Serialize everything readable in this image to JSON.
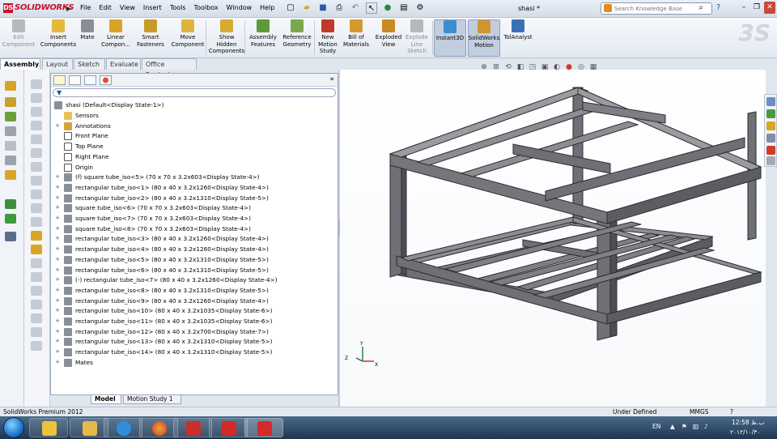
{
  "app": {
    "logo_text": "SOLIDWORKS",
    "doc_title": "shasi *",
    "menu": [
      "File",
      "Edit",
      "View",
      "Insert",
      "Tools",
      "Toolbox",
      "Window",
      "Help"
    ],
    "search_placeholder": "Search Knowledge Base"
  },
  "ribbon": {
    "buttons": [
      {
        "label": "Edit Component",
        "state": "disabled",
        "icon_color": "#b8b8b8"
      },
      {
        "label": "Insert Components",
        "state": "normal",
        "icon_color": "#e2b93b"
      },
      {
        "label": "Mate",
        "state": "normal",
        "icon_color": "#8a8f96"
      },
      {
        "label": "Linear Compon...",
        "state": "normal",
        "icon_color": "#d9a327"
      },
      {
        "label": "Smart Fasteners",
        "state": "normal",
        "icon_color": "#c79a2a"
      },
      {
        "label": "Move Component",
        "state": "normal",
        "icon_color": "#e0b240"
      },
      {
        "label": "Show Hidden Components",
        "state": "normal",
        "icon_color": "#d7aa33"
      },
      {
        "label": "Assembly Features",
        "state": "normal",
        "icon_color": "#5e9a3a"
      },
      {
        "label": "Reference Geometry",
        "state": "normal",
        "icon_color": "#7aa84c"
      },
      {
        "label": "New Motion Study",
        "state": "normal",
        "icon_color": "#c0392b"
      },
      {
        "label": "Bill of Materials",
        "state": "normal",
        "icon_color": "#d29b2c"
      },
      {
        "label": "Exploded View",
        "state": "normal",
        "icon_color": "#c88a22"
      },
      {
        "label": "Explode Line Sketch",
        "state": "disabled",
        "icon_color": "#b8b8b8"
      },
      {
        "label": "Instant3D",
        "state": "active",
        "icon_color": "#3b8fd1"
      },
      {
        "label": "SolidWorks Motion",
        "state": "active",
        "icon_color": "#d09430"
      },
      {
        "label": "TolAnalyst",
        "state": "normal",
        "icon_color": "#3b6fb5"
      }
    ]
  },
  "command_tabs": [
    "Assembly",
    "Layout",
    "Sketch",
    "Evaluate",
    "Office Products"
  ],
  "tree": {
    "root": "shasi  (Default<Display State-1>)",
    "items": [
      {
        "label": "Sensors",
        "icon": "sensor-icon"
      },
      {
        "label": "Annotations",
        "icon": "annotations-icon"
      },
      {
        "label": "Front Plane",
        "icon": "plane-icon"
      },
      {
        "label": "Top Plane",
        "icon": "plane-icon"
      },
      {
        "label": "Right Plane",
        "icon": "plane-icon"
      },
      {
        "label": "Origin",
        "icon": "origin-icon"
      },
      {
        "label": "(f) square tube_iso<5> (70 x 70 x 3.2x603<Display State-4>)",
        "icon": "part-icon"
      },
      {
        "label": "rectangular tube_iso<1> (80 x 40 x 3.2x1260<Display State-4>)",
        "icon": "part-icon"
      },
      {
        "label": "rectangular tube_iso<2> (80 x 40 x 3.2x1310<Display State-5>)",
        "icon": "part-icon"
      },
      {
        "label": "square tube_iso<6> (70 x 70 x 3.2x603<Display State-4>)",
        "icon": "part-icon"
      },
      {
        "label": "square tube_iso<7> (70 x 70 x 3.2x603<Display State-4>)",
        "icon": "part-icon"
      },
      {
        "label": "square tube_iso<8> (70 x 70 x 3.2x603<Display State-4>)",
        "icon": "part-icon"
      },
      {
        "label": "rectangular tube_iso<3> (80 x 40 x 3.2x1260<Display State-4>)",
        "icon": "part-icon"
      },
      {
        "label": "rectangular tube_iso<4> (80 x 40 x 3.2x1260<Display State-4>)",
        "icon": "part-icon"
      },
      {
        "label": "rectangular tube_iso<5> (80 x 40 x 3.2x1310<Display State-5>)",
        "icon": "part-icon"
      },
      {
        "label": "rectangular tube_iso<6> (80 x 40 x 3.2x1310<Display State-5>)",
        "icon": "part-icon"
      },
      {
        "label": "(-) rectangular tube_iso<7> (80 x 40 x 3.2x1260<Display State-4>)",
        "icon": "part-icon"
      },
      {
        "label": "rectangular tube_iso<8> (80 x 40 x 3.2x1310<Display State-5>)",
        "icon": "part-icon"
      },
      {
        "label": "rectangular tube_iso<9> (80 x 40 x 3.2x1260<Display State-4>)",
        "icon": "part-icon"
      },
      {
        "label": "rectangular tube_iso<10> (80 x 40 x 3.2x1035<Display State-6>)",
        "icon": "part-icon"
      },
      {
        "label": "rectangular tube_iso<11> (80 x 40 x 3.2x1035<Display State-6>)",
        "icon": "part-icon"
      },
      {
        "label": "rectangular tube_iso<12> (80 x 40 x 3.2x700<Display State-7>)",
        "icon": "part-icon"
      },
      {
        "label": "rectangular tube_iso<13> (80 x 40 x 3.2x1310<Display State-5>)",
        "icon": "part-icon"
      },
      {
        "label": "rectangular tube_iso<14> (80 x 40 x 3.2x1310<Display State-5>)",
        "icon": "part-icon"
      },
      {
        "label": "Mates",
        "icon": "mates-icon"
      }
    ]
  },
  "bottom_tabs": [
    "Model",
    "Motion Study 1"
  ],
  "triad": {
    "x": "X",
    "y": "Y",
    "z": "Z"
  },
  "status": {
    "product": "SolidWorks Premium 2012",
    "state": "Under Defined",
    "units": "MMGS",
    "help": "?"
  },
  "taskbar": {
    "lang": "EN",
    "time": "12:58 ب.ظ",
    "date": "۲۰۱۲/۱۰/۳۰"
  },
  "colors": {
    "frame_face": "#75767a",
    "frame_edge": "#2b2c30",
    "frame_light": "#9a9ba0"
  }
}
